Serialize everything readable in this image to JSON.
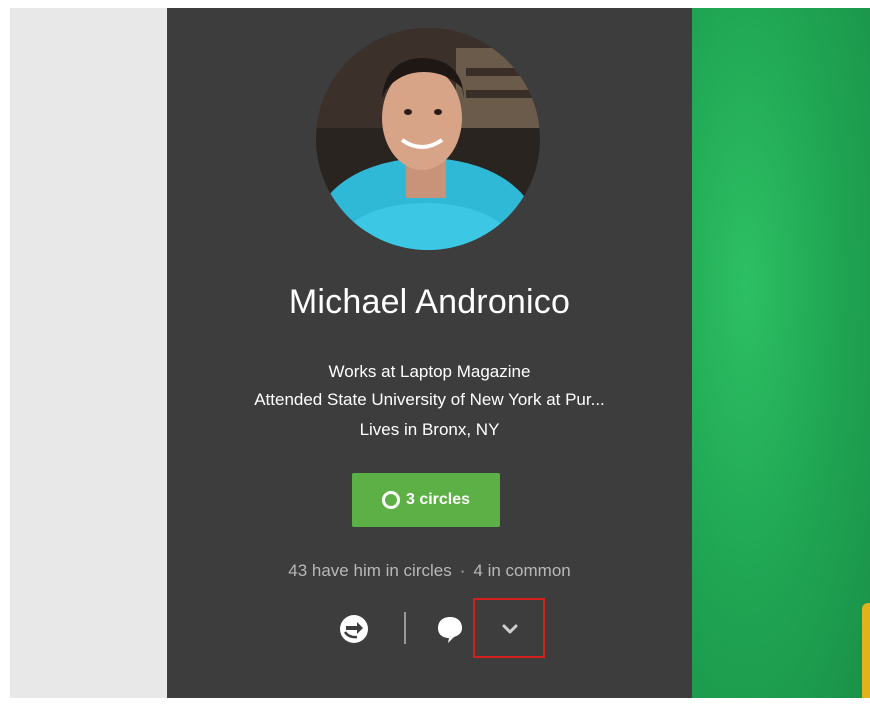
{
  "profile": {
    "name": "Michael Andronico",
    "works": "Works at Laptop Magazine",
    "education": "Attended State University of New York at Pur...",
    "lives": "Lives in Bronx, NY"
  },
  "circles_button": {
    "label": "3 circles",
    "icon": "circle-icon"
  },
  "stats": {
    "have_him": "43 have him in circles",
    "separator": "·",
    "in_common": "4 in common"
  },
  "actions": [
    {
      "name": "share",
      "icon": "share-icon"
    },
    {
      "name": "comment",
      "icon": "comment-icon"
    },
    {
      "name": "more",
      "icon": "chevron-down-icon"
    }
  ],
  "colors": {
    "card_bg": "#3d3d3d",
    "button_green": "#5cb046",
    "cover_green": "#1fa452",
    "highlight_red": "#d41f1f"
  }
}
